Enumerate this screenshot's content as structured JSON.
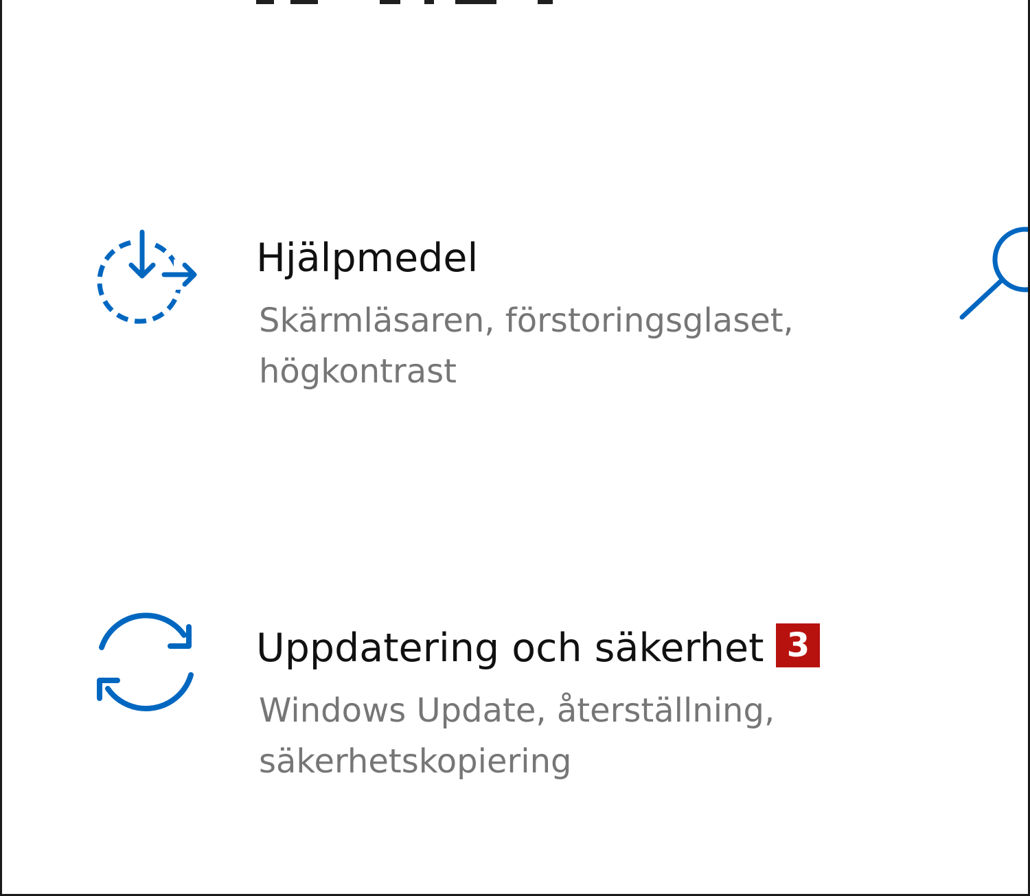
{
  "tiles": [
    {
      "title": "Hjälpmedel",
      "desc_line1": "Skärmläsaren, förstoringsglaset,",
      "desc_line2": "högkontrast",
      "icon": "accessibility-icon"
    },
    {
      "title": "Uppdatering och säkerhet",
      "badge": "3",
      "desc_line1": "Windows Update, återställning,",
      "desc_line2": "säkerhetskopiering",
      "icon": "sync-update-icon"
    }
  ],
  "right_edge_tile_icon": "search-icon",
  "colors": {
    "accent": "#0067c0",
    "badge": "#b8120f",
    "title_text": "#111111",
    "secondary_text": "#767676"
  }
}
